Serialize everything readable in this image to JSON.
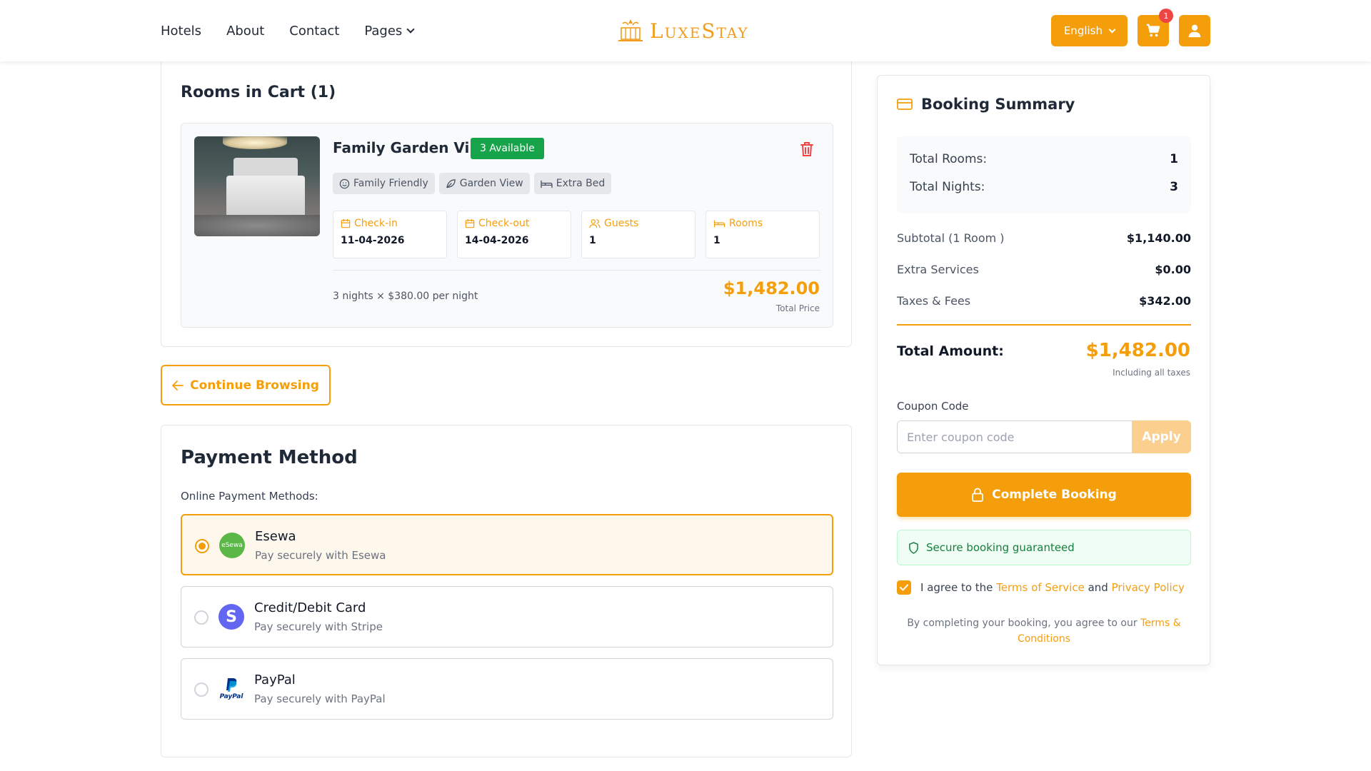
{
  "header": {
    "nav": [
      {
        "label": "Hotels"
      },
      {
        "label": "About"
      },
      {
        "label": "Contact"
      },
      {
        "label": "Pages"
      }
    ],
    "logo_text": "LuxeStay",
    "language": "English",
    "cart_count": "1"
  },
  "cart": {
    "title": "Rooms in Cart (1)",
    "room": {
      "name": "Family Garden Villa",
      "availability": "3 Available",
      "amenities": [
        "Family Friendly",
        "Garden View",
        "Extra Bed"
      ],
      "fields": [
        {
          "label": "Check-in",
          "value": "11-04-2026"
        },
        {
          "label": "Check-out",
          "value": "14-04-2026"
        },
        {
          "label": "Guests",
          "value": "1"
        },
        {
          "label": "Rooms",
          "value": "1"
        }
      ],
      "nights_text": "3 nights × $380.00 per night",
      "total_price": "$1,482.00",
      "total_price_label": "Total Price"
    },
    "continue_label": "Continue Browsing"
  },
  "payment": {
    "title": "Payment Method",
    "subtitle": "Online Payment Methods:",
    "options": [
      {
        "name": "Esewa",
        "desc": "Pay securely with Esewa",
        "logo_text": "eSewa",
        "selected": true
      },
      {
        "name": "Credit/Debit Card",
        "desc": "Pay securely with Stripe",
        "logo_text": "S",
        "selected": false
      },
      {
        "name": "PayPal",
        "desc": "Pay securely with PayPal",
        "logo_text": "PayPal",
        "selected": false
      }
    ]
  },
  "summary": {
    "title": "Booking Summary",
    "total_rooms_label": "Total Rooms:",
    "total_rooms": "1",
    "total_nights_label": "Total Nights:",
    "total_nights": "3",
    "subtotal_label": "Subtotal (1 Room )",
    "subtotal": "$1,140.00",
    "extra_label": "Extra Services",
    "extra": "$0.00",
    "taxes_label": "Taxes & Fees",
    "taxes": "$342.00",
    "total_label": "Total Amount:",
    "total": "$1,482.00",
    "including": "Including all taxes",
    "coupon_label": "Coupon Code",
    "coupon_placeholder": "Enter coupon code",
    "apply_label": "Apply",
    "complete_label": "Complete Booking",
    "secure_text": "Secure booking guaranteed",
    "agree_prefix": "I agree to the",
    "terms_link": "Terms of Service",
    "agree_and": "and",
    "privacy_link": "Privacy Policy",
    "fine_prefix": "By completing your booking, you agree to our",
    "fine_link": "Terms & Conditions"
  },
  "colors": {
    "accent": "#f59e0b",
    "success": "#16a34a",
    "danger": "#ef4444"
  }
}
